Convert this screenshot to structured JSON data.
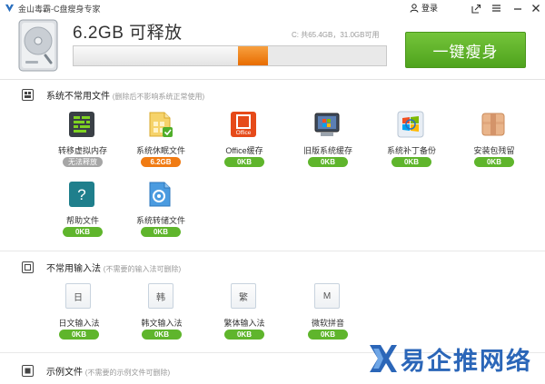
{
  "window": {
    "title": "金山毒霸-C盘瘦身专家",
    "login_label": "登录"
  },
  "header": {
    "releasable_size": "6.2GB 可释放",
    "disk_usage": "C: 共65.4GB，31.0GB可用",
    "usage_fraction": 0.526,
    "releasable_fraction": 0.095,
    "slim_button_label": "一键瘦身",
    "colors": {
      "free_bar": "#f07b13",
      "slim_button": "#5cb229"
    }
  },
  "sections": [
    {
      "title": "系统不常用文件",
      "note": "(删除后不影响系统正常使用)",
      "items": [
        {
          "label": "转移虚拟内存",
          "badge": "无法释放",
          "badge_style": "gray",
          "icon": "equalizer-icon"
        },
        {
          "label": "系统休眠文件",
          "badge": "6.2GB",
          "badge_style": "orange",
          "icon": "hibernate-file-icon"
        },
        {
          "label": "Office缓存",
          "badge": "0KB",
          "badge_style": "green",
          "icon": "office-icon"
        },
        {
          "label": "旧版系统缓存",
          "badge": "0KB",
          "badge_style": "green",
          "icon": "old-system-icon"
        },
        {
          "label": "系统补丁备份",
          "badge": "0KB",
          "badge_style": "green",
          "icon": "windows-logo-icon"
        },
        {
          "label": "安装包残留",
          "badge": "0KB",
          "badge_style": "green",
          "icon": "package-icon"
        },
        {
          "label": "帮助文件",
          "badge": "0KB",
          "badge_style": "green",
          "icon": "help-icon"
        },
        {
          "label": "系统转储文件",
          "badge": "0KB",
          "badge_style": "green",
          "icon": "dump-file-icon"
        }
      ]
    },
    {
      "title": "不常用输入法",
      "note": "(不需要的输入法可删除)",
      "items": [
        {
          "label": "日文输入法",
          "badge": "0KB",
          "glyph": "日"
        },
        {
          "label": "韩文输入法",
          "badge": "0KB",
          "glyph": "韩"
        },
        {
          "label": "繁体输入法",
          "badge": "0KB",
          "glyph": "繁"
        },
        {
          "label": "微软拼音",
          "badge": "0KB",
          "glyph": "M"
        }
      ]
    },
    {
      "title": "示例文件",
      "note": "(不需要的示例文件可删除)",
      "items": []
    }
  ],
  "watermark": {
    "text": "易企推网络"
  }
}
